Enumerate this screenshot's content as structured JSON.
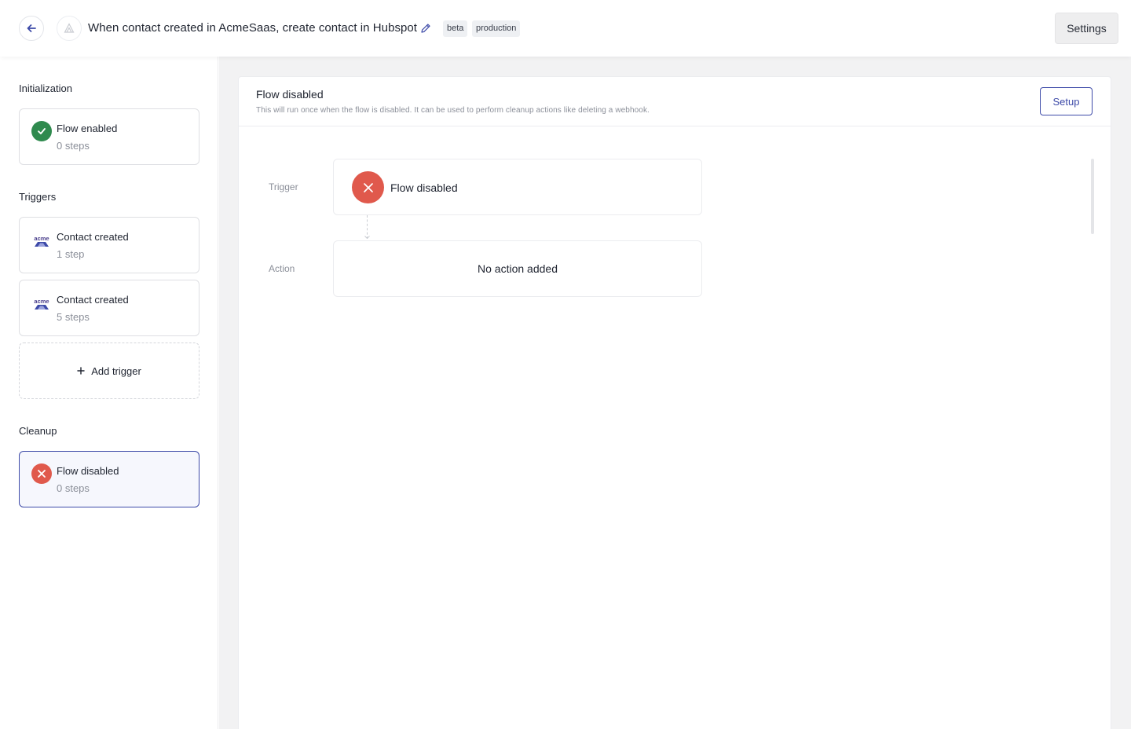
{
  "header": {
    "title": "When contact created in AcmeSaas, create contact in Hubspot",
    "tags": [
      "beta",
      "production"
    ],
    "settings_label": "Settings"
  },
  "sidebar": {
    "sections": [
      {
        "label": "Initialization",
        "cards": [
          {
            "title": "Flow enabled",
            "sub": "0 steps",
            "icon": "check-circle-icon",
            "color": "#2f8a4e"
          }
        ]
      },
      {
        "label": "Triggers",
        "cards": [
          {
            "title": "Contact created",
            "sub": "1 step",
            "icon": "acme-logo-icon"
          },
          {
            "title": "Contact created",
            "sub": "5 steps",
            "icon": "acme-logo-icon"
          }
        ],
        "add_label": "Add trigger"
      },
      {
        "label": "Cleanup",
        "cards": [
          {
            "title": "Flow disabled",
            "sub": "0 steps",
            "icon": "x-circle-icon",
            "color": "#e0594c",
            "selected": true
          }
        ]
      }
    ]
  },
  "panel": {
    "title": "Flow disabled",
    "description": "This will run once when the flow is disabled. It can be used to perform cleanup actions like deleting a webhook.",
    "setup_label": "Setup",
    "trigger_label": "Trigger",
    "trigger_name": "Flow disabled",
    "action_label": "Action",
    "action_text": "No action added"
  },
  "colors": {
    "accent": "#3d4aa8",
    "success": "#2f8a4e",
    "danger": "#e0594c"
  },
  "acme_logo_text": "acme"
}
